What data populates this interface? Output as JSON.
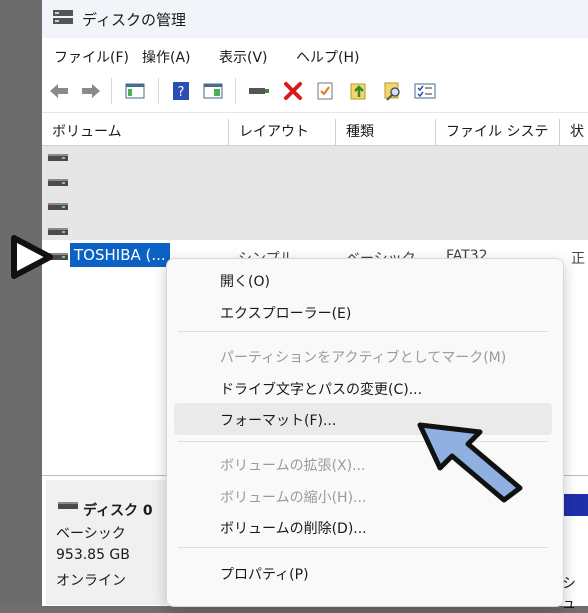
{
  "window": {
    "title": "ディスクの管理"
  },
  "menu": [
    "ファイル(F)",
    "操作(A)",
    "表示(V)",
    "ヘルプ(H)"
  ],
  "columns": [
    "ボリューム",
    "レイアウト",
    "種類",
    "ファイル システム",
    "状"
  ],
  "selected_row": {
    "volume": "TOSHIBA (...",
    "layout": "シンプル",
    "type": "ベーシック",
    "filesystem": "FAT32",
    "status": "正"
  },
  "disk": {
    "name": "ディスク 0",
    "type": "ベーシック",
    "size": "953.85 GB",
    "state": "オンライン",
    "right_text": "シュ"
  },
  "context_menu": [
    {
      "label": "開く(O)",
      "enabled": true
    },
    {
      "label": "エクスプローラー(E)",
      "enabled": true
    },
    {
      "label": "パーティションをアクティブとしてマーク(M)",
      "enabled": false
    },
    {
      "label": "ドライブ文字とパスの変更(C)...",
      "enabled": true
    },
    {
      "label": "フォーマット(F)...",
      "enabled": true,
      "highlighted": true
    },
    {
      "label": "ボリュームの拡張(X)...",
      "enabled": false
    },
    {
      "label": "ボリュームの縮小(H)...",
      "enabled": false
    },
    {
      "label": "ボリュームの削除(D)...",
      "enabled": true
    },
    {
      "label": "プロパティ(P)",
      "enabled": true
    }
  ],
  "toolbar_icons": [
    "back-arrow-icon",
    "forward-arrow-icon",
    "console-tree-icon",
    "help-icon",
    "show-hide-icon",
    "connect-drive-icon",
    "delete-icon",
    "check-icon",
    "export-icon",
    "search-icon",
    "properties-icon"
  ],
  "colors": {
    "selection": "#0b62c4",
    "pointer_arrow": "#8fb0e0",
    "delete": "#d81b1b"
  }
}
